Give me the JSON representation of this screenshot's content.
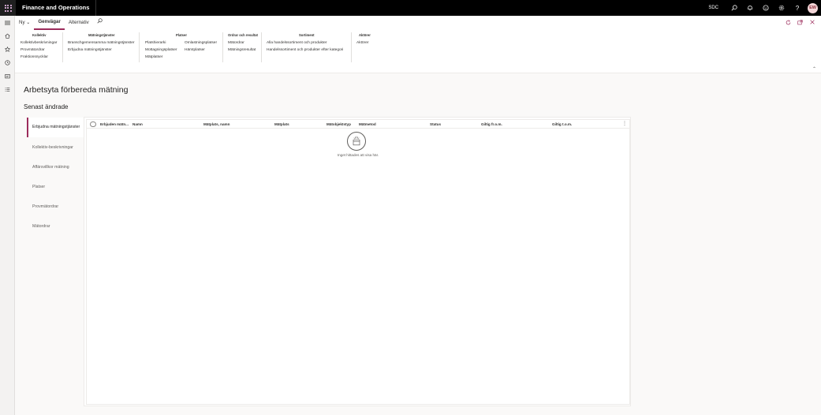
{
  "app": {
    "title": "Finance and Operations",
    "company": "SDC",
    "user_initials": "EW"
  },
  "actionbar": {
    "new_label": "Ny",
    "tabs": [
      "Genvägar",
      "Alternativ"
    ]
  },
  "ribbon": {
    "groups": [
      {
        "title": "Kollektiv",
        "links": [
          "Kollektivbeskrivningar",
          "Provmätordrar",
          "Fraktionsnycklar"
        ]
      },
      {
        "title": "Mätningstjänster",
        "links": [
          "Branschgemensamma mätningstjänster",
          "Erbjudna mätningstjänster"
        ]
      },
      {
        "title": "Platser",
        "links": [
          "Platshierarki",
          "Mottagningsplatser",
          "Mätplatser",
          "Omlastningsplatser",
          "Hämtplatser"
        ]
      },
      {
        "title": "Ordrar och resultat",
        "links": [
          "Mätordrar",
          "Mätningsresultat"
        ]
      },
      {
        "title": "Sortiment",
        "links": [
          "Alla handelssortiment och produkter",
          "Handelssortiment och produkter efter kategori"
        ]
      },
      {
        "title": "Aktörer",
        "links": [
          "Aktörer"
        ]
      }
    ]
  },
  "page": {
    "title": "Arbetsyta förbereda mätning",
    "section": "Senast ändrade"
  },
  "tabs": [
    "Erbjudna mätningstjänster",
    "Kollektiv-beskrivningar",
    "Affärsvillkor mätning",
    "Platser",
    "Provmätordrar",
    "Mätordrar"
  ],
  "grid": {
    "columns": [
      "Erbjuden mätn...",
      "Namn",
      "Mätplats, namn",
      "Mätplats",
      "Mätobjektstyp",
      "Mätmetod",
      "Status",
      "Giltig fr.o.m.",
      "Giltig t.o.m."
    ],
    "empty_text": "Inget hittades att visa här."
  },
  "colors": {
    "accent": "#9c2c5b",
    "topbar": "#000000"
  }
}
